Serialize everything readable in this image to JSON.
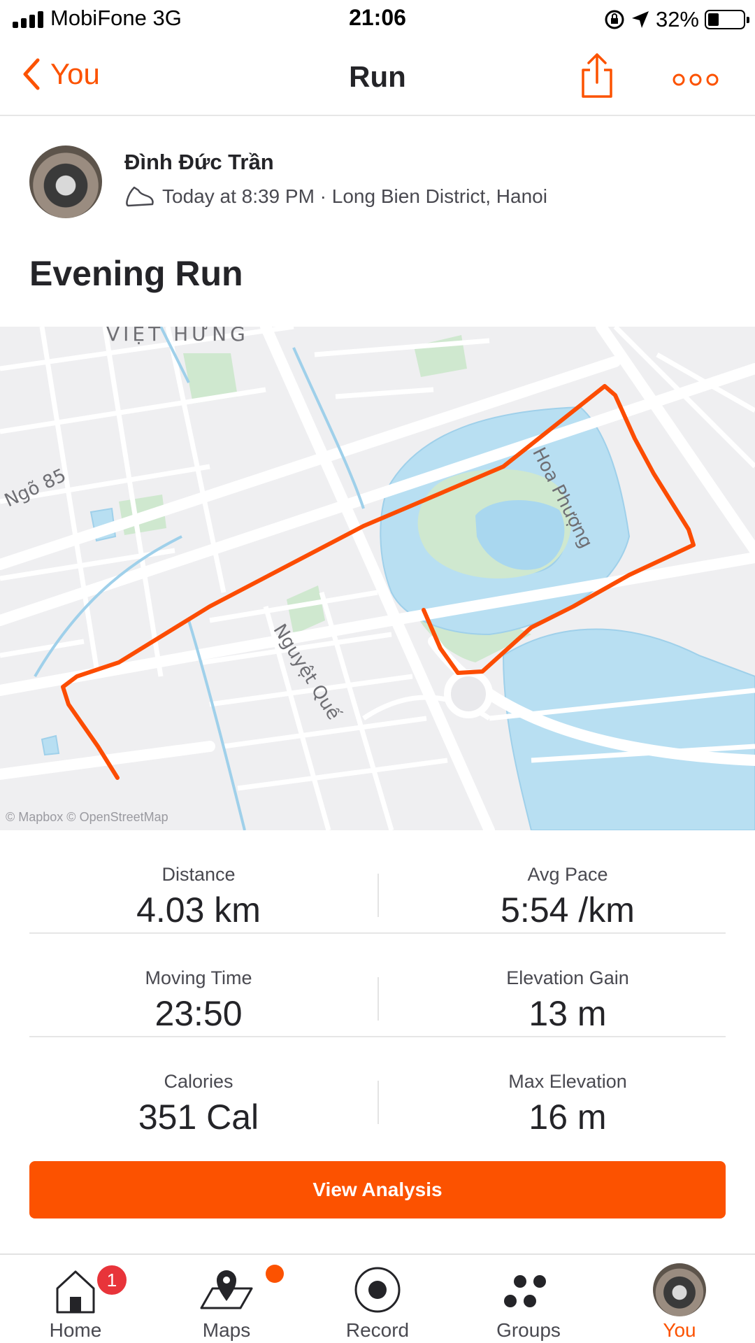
{
  "status_bar": {
    "carrier": "MobiFone  3G",
    "time": "21:06",
    "battery_text": "32%",
    "battery_level": 0.32
  },
  "nav": {
    "back_label": "You",
    "title": "Run",
    "accent_color": "#fc5200"
  },
  "athlete": {
    "name": "Đình Đức Trần",
    "activity_meta": "Today at 8:39 PM · Long Bien District, Hanoi",
    "meta_icon": "shoe-icon"
  },
  "activity": {
    "title": "Evening Run"
  },
  "map": {
    "labels": {
      "viet_hung": "VIỆT HƯNG",
      "ngo85": "Ngõ 85",
      "hoa_phuong": "Hoa Phượng",
      "nguyet_que": "Nguyệt Quế"
    },
    "credit": "© Mapbox © OpenStreetMap",
    "route_color": "#fc4c02"
  },
  "stats": [
    {
      "label": "Distance",
      "value": "4.03 km"
    },
    {
      "label": "Avg Pace",
      "value": "5:54 /km"
    },
    {
      "label": "Moving Time",
      "value": "23:50"
    },
    {
      "label": "Elevation Gain",
      "value": "13 m"
    },
    {
      "label": "Calories",
      "value": "351 Cal"
    },
    {
      "label": "Max Elevation",
      "value": "16 m"
    }
  ],
  "analysis_button": "View Analysis",
  "tabbar": {
    "tabs": [
      {
        "label": "Home",
        "icon": "home-icon"
      },
      {
        "label": "Maps",
        "icon": "map-icon"
      },
      {
        "label": "Record",
        "icon": "record-icon"
      },
      {
        "label": "Groups",
        "icon": "groups-icon"
      },
      {
        "label": "You",
        "icon": "avatar"
      }
    ],
    "home_badge": "1",
    "active_tab": "You"
  }
}
